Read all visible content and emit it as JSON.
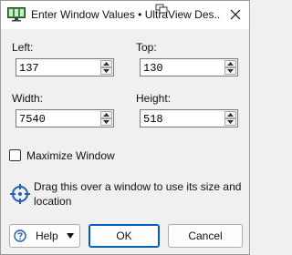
{
  "window": {
    "title": "Enter Window Values • UltraView Des..."
  },
  "fields": {
    "left": {
      "label": "Left:",
      "value": "137"
    },
    "top": {
      "label": "Top:",
      "value": "130"
    },
    "width": {
      "label": "Width:",
      "value": "7540"
    },
    "height": {
      "label": "Height:",
      "value": "518"
    }
  },
  "maximize": {
    "label": "Maximize Window",
    "checked": false
  },
  "drag": {
    "text": "Drag this over a window to use its size and location"
  },
  "buttons": {
    "help": "Help",
    "ok": "OK",
    "cancel": "Cancel"
  },
  "colors": {
    "accent": "#005fb8",
    "icon_blue": "#1f5fb4",
    "icon_green": "#3a8f3a"
  }
}
